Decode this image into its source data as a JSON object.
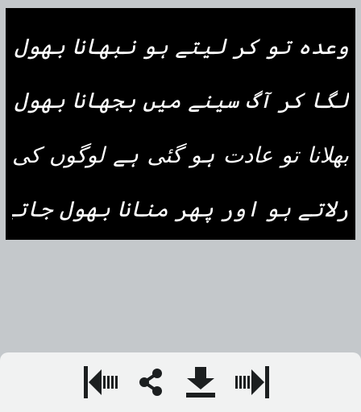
{
  "poem": {
    "lines": [
      "وعدہ تو کر لیتے ہو نبھانا بھول جاتے ہو",
      "لگا کر آگ سینے میں بجھانا بھول جاتے ہو",
      "بھلانا تو عادت ہو گئی ہے لوگوں کی",
      "رلاتے ہو اور پھر منانا بھول جاتے ہو"
    ]
  },
  "toolbar": {
    "icons": {
      "previous": "previous-page-icon",
      "share": "share-icon",
      "download": "download-icon",
      "next": "next-page-icon"
    }
  },
  "colors": {
    "background": "#c4c8cb",
    "card": "#000000",
    "text": "#ffffff",
    "toolbar": "#f1f2f2",
    "icon": "#1c1f20"
  }
}
